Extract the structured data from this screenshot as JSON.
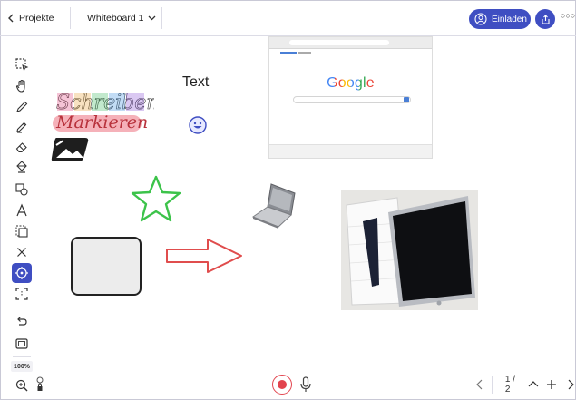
{
  "header": {
    "back_label": "Projekte",
    "board_title": "Whiteboard 1",
    "invite_label": "Einladen"
  },
  "canvas": {
    "text_item": "Text",
    "handwriting_1": "Schreiben",
    "handwriting_2": "Markieren",
    "browser": {
      "logo": "Google"
    }
  },
  "toolbar": {
    "tools": [
      "select",
      "hand",
      "pen",
      "marker",
      "eraser",
      "fill",
      "shapes",
      "text",
      "sticky-note",
      "close",
      "laser-pointer",
      "crop",
      "undo",
      "screen"
    ],
    "active_tool": "laser-pointer",
    "zoom": "100%"
  },
  "footer": {
    "page_indicator": "1 / 2"
  },
  "colors": {
    "accent": "#3f4ec2",
    "record": "#e2444e",
    "star": "#3cc34a",
    "arrow": "#e04d4d"
  }
}
